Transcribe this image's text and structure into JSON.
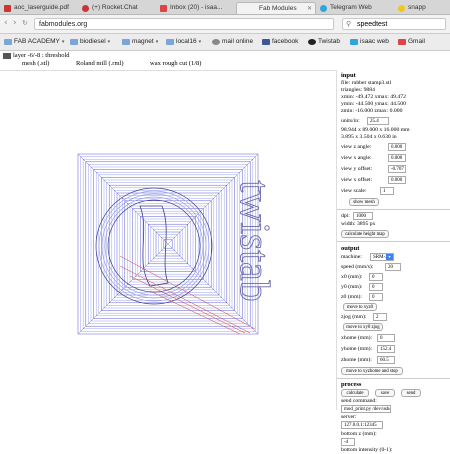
{
  "browser": {
    "tabs": [
      {
        "label": "aoc_laserguide.pdf",
        "color": "#c33"
      },
      {
        "label": "(+) Rocket.Chat",
        "color": "#c33"
      },
      {
        "label": "Inbox (20) - isaa...",
        "color": "#d44"
      },
      {
        "label": "Fab Modules",
        "color": "#999"
      },
      {
        "label": "Telegram Web",
        "color": "#2ca5e0"
      },
      {
        "label": "snapp",
        "color": "#f5c518"
      }
    ],
    "url": "fabmodules.org",
    "search_value": "speedtest"
  },
  "bookmarks": [
    {
      "label": "FAB ACADEMY",
      "chevron": true
    },
    {
      "label": "biodiesel",
      "chevron": true
    },
    {
      "label": "magnet",
      "chevron": true
    },
    {
      "label": "local16",
      "chevron": true
    },
    {
      "label": "mail online",
      "chevron": false
    },
    {
      "label": "facebook",
      "chevron": false
    },
    {
      "label": "Twistab",
      "chevron": false
    },
    {
      "label": "isaac web",
      "chevron": false
    },
    {
      "label": "Gmail",
      "chevron": false
    }
  ],
  "app": {
    "breadcrumb": "layer -6/-8 : threshold",
    "module_tabs": [
      "mesh (.stl)",
      "Roland mill (.rml)",
      "wax rough cut (1/8)"
    ],
    "model_text": "twistab"
  },
  "panel": {
    "input_heading": "input",
    "file": "file: rubber stamp3.stl",
    "triangles": "triangles: 9884",
    "xminmax": "xmin: -49.472 xmax: 49.472",
    "yminmax": "ymin: -44.500 ymax: 44.500",
    "zminmax": "zmin: -16.000 zmax: 0.000",
    "units_label": "units/in:",
    "units_value": "25.4",
    "dims_mm": "98.944 x 89.000 x 16.000 mm",
    "dims_in": "3.895 x 3.504 x 0.630 in",
    "view_z_label": "view z angle:",
    "view_z_value": "0.000",
    "view_x_label": "view x angle:",
    "view_x_value": "0.000",
    "view_y_offset_label": "view y offset:",
    "view_y_offset_value": "-0.707",
    "view_x_offset_label": "view x offset:",
    "view_x_offset_value": "0.000",
    "view_scale_label": "view scale:",
    "view_scale_value": "1",
    "show_mesh": "show mesh",
    "dpi_label": "dpi:",
    "dpi_value": "1000",
    "width_text": "width: 3895 px",
    "calc_height_map": "calculate height map",
    "output_heading": "output",
    "machine_label": "machine:",
    "machine_value": "SRM-20",
    "speed_label": "speed (mm/s):",
    "speed_value": "20",
    "x0_label": "x0 (mm):",
    "x0_value": "0",
    "y0_label": "y0 (mm):",
    "y0_value": "0",
    "z0_label": "z0 (mm):",
    "z0_value": "0",
    "move_xyz0": "move to xyz0",
    "zjog_label": "zjog (mm):",
    "zjog_value": "2",
    "move_xy0_zjog": "move to xy0 zjog",
    "xhome_label": "xhome (mm):",
    "xhome_value": "0",
    "yhome_label": "yhome (mm):",
    "yhome_value": "152.4",
    "zhome_label": "zhome (mm):",
    "zhome_value": "60.5",
    "move_home": "move to xyzhome and stop",
    "process_heading": "process",
    "calculate": "calculate",
    "save": "save",
    "send": "send",
    "send_command_label": "send command:",
    "send_command_value": "mod_print.py /dev/usb/lp",
    "server_label": "server:",
    "server_value": "127.0.0.1:12345",
    "bottom_z_label": "bottom z (mm):",
    "bottom_z_value": "-4",
    "bottom_intensity_label": "bottom intensity (0-1):"
  },
  "colors": {
    "toolpath": "#5b5bd6",
    "toolpath_light": "#9aa0e8",
    "diagonal": "#d24040"
  }
}
